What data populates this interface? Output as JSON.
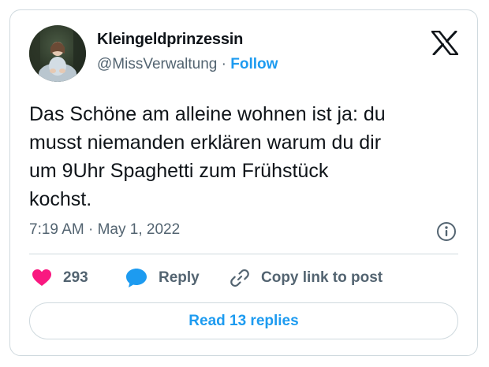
{
  "author": {
    "display_name": "Kleingeldprinzessin",
    "handle": "@MissVerwaltung",
    "separator": "·",
    "follow_label": "Follow",
    "avatar_icon": "profile-photo-icon"
  },
  "tweet": {
    "text": "Das Schöne am alleine wohnen ist ja: du\nmusst niemanden erklären warum du dir\num 9Uhr Spaghetti zum Frühstück\nkochst.",
    "time": "7:19 AM",
    "date_separator": "·",
    "date": "May 1, 2022"
  },
  "actions": {
    "likes_count": "293",
    "reply_label": "Reply",
    "copy_label": "Copy link to post",
    "read_replies_label": "Read 13 replies"
  },
  "icons": {
    "brand": "x-logo-icon",
    "info": "info-icon",
    "like": "heart-icon",
    "reply": "speech-bubble-icon",
    "copy": "link-icon"
  },
  "colors": {
    "accent": "#1d9bf0",
    "like": "#f91880",
    "text": "#0f1419",
    "secondary": "#536471",
    "border": "#cfd9de"
  }
}
